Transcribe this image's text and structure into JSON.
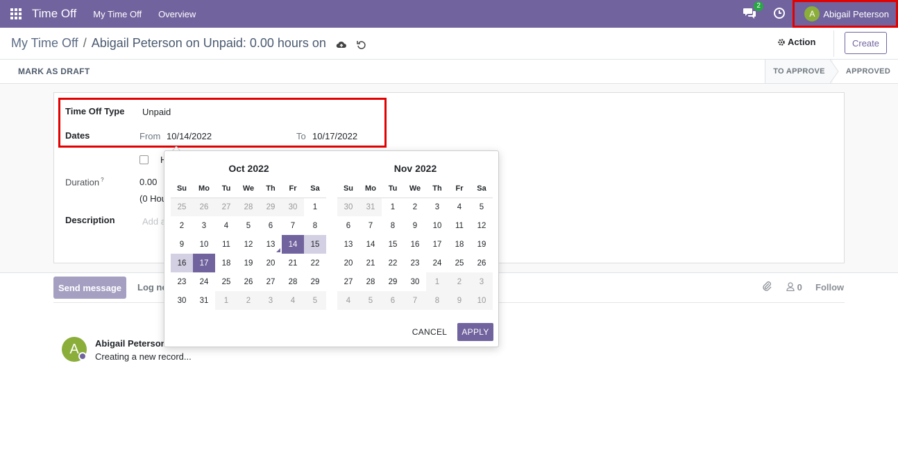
{
  "navbar": {
    "app_title": "Time Off",
    "menu": [
      "My Time Off",
      "Overview"
    ],
    "messages_badge": "2",
    "user_initial": "A",
    "user_name": "Abigail Peterson"
  },
  "breadcrumb": {
    "parent": "My Time Off",
    "separator": "/",
    "current": "Abigail Peterson on Unpaid: 0.00 hours on"
  },
  "toolbar": {
    "action_label": "Action",
    "create_label": "Create"
  },
  "statusbar": {
    "mark_draft_label": "MARK AS DRAFT",
    "stages": [
      "TO APPROVE",
      "APPROVED"
    ]
  },
  "form": {
    "time_off_type_label": "Time Off Type",
    "time_off_type_value": "Unpaid",
    "dates_label": "Dates",
    "from_label": "From",
    "from_value": "10/14/2022",
    "to_label": "To",
    "to_value": "10/17/2022",
    "half_day_label": "H",
    "duration_label": "Duration",
    "duration_help": "?",
    "duration_value": "0.00",
    "duration_hours": "(0 Hou",
    "description_label": "Description",
    "description_placeholder": "Add a"
  },
  "datepicker": {
    "weekdays": [
      "Su",
      "Mo",
      "Tu",
      "We",
      "Th",
      "Fr",
      "Sa"
    ],
    "left": {
      "title": "Oct 2022",
      "weeks": [
        [
          "25",
          "26",
          "27",
          "28",
          "29",
          "30",
          "1"
        ],
        [
          "2",
          "3",
          "4",
          "5",
          "6",
          "7",
          "8"
        ],
        [
          "9",
          "10",
          "11",
          "12",
          "13",
          "14",
          "15"
        ],
        [
          "16",
          "17",
          "18",
          "19",
          "20",
          "21",
          "22"
        ],
        [
          "23",
          "24",
          "25",
          "26",
          "27",
          "28",
          "29"
        ],
        [
          "30",
          "31",
          "1",
          "2",
          "3",
          "4",
          "5"
        ]
      ]
    },
    "right": {
      "title": "Nov 2022",
      "weeks": [
        [
          "30",
          "31",
          "1",
          "2",
          "3",
          "4",
          "5"
        ],
        [
          "6",
          "7",
          "8",
          "9",
          "10",
          "11",
          "12"
        ],
        [
          "13",
          "14",
          "15",
          "16",
          "17",
          "18",
          "19"
        ],
        [
          "20",
          "21",
          "22",
          "23",
          "24",
          "25",
          "26"
        ],
        [
          "27",
          "28",
          "29",
          "30",
          "1",
          "2",
          "3"
        ],
        [
          "4",
          "5",
          "6",
          "7",
          "8",
          "9",
          "10"
        ]
      ]
    },
    "cancel_label": "CANCEL",
    "apply_label": "APPLY"
  },
  "chatter": {
    "send_message_label": "Send message",
    "log_note_label": "Log no",
    "followers_count": "0",
    "follow_label": "Follow",
    "message_author": "Abigail Peterson",
    "message_initial": "A",
    "message_body": "Creating a new record..."
  },
  "colors": {
    "brand": "#71639e",
    "highlight": "#e20000",
    "avatar": "#8bae3b"
  }
}
